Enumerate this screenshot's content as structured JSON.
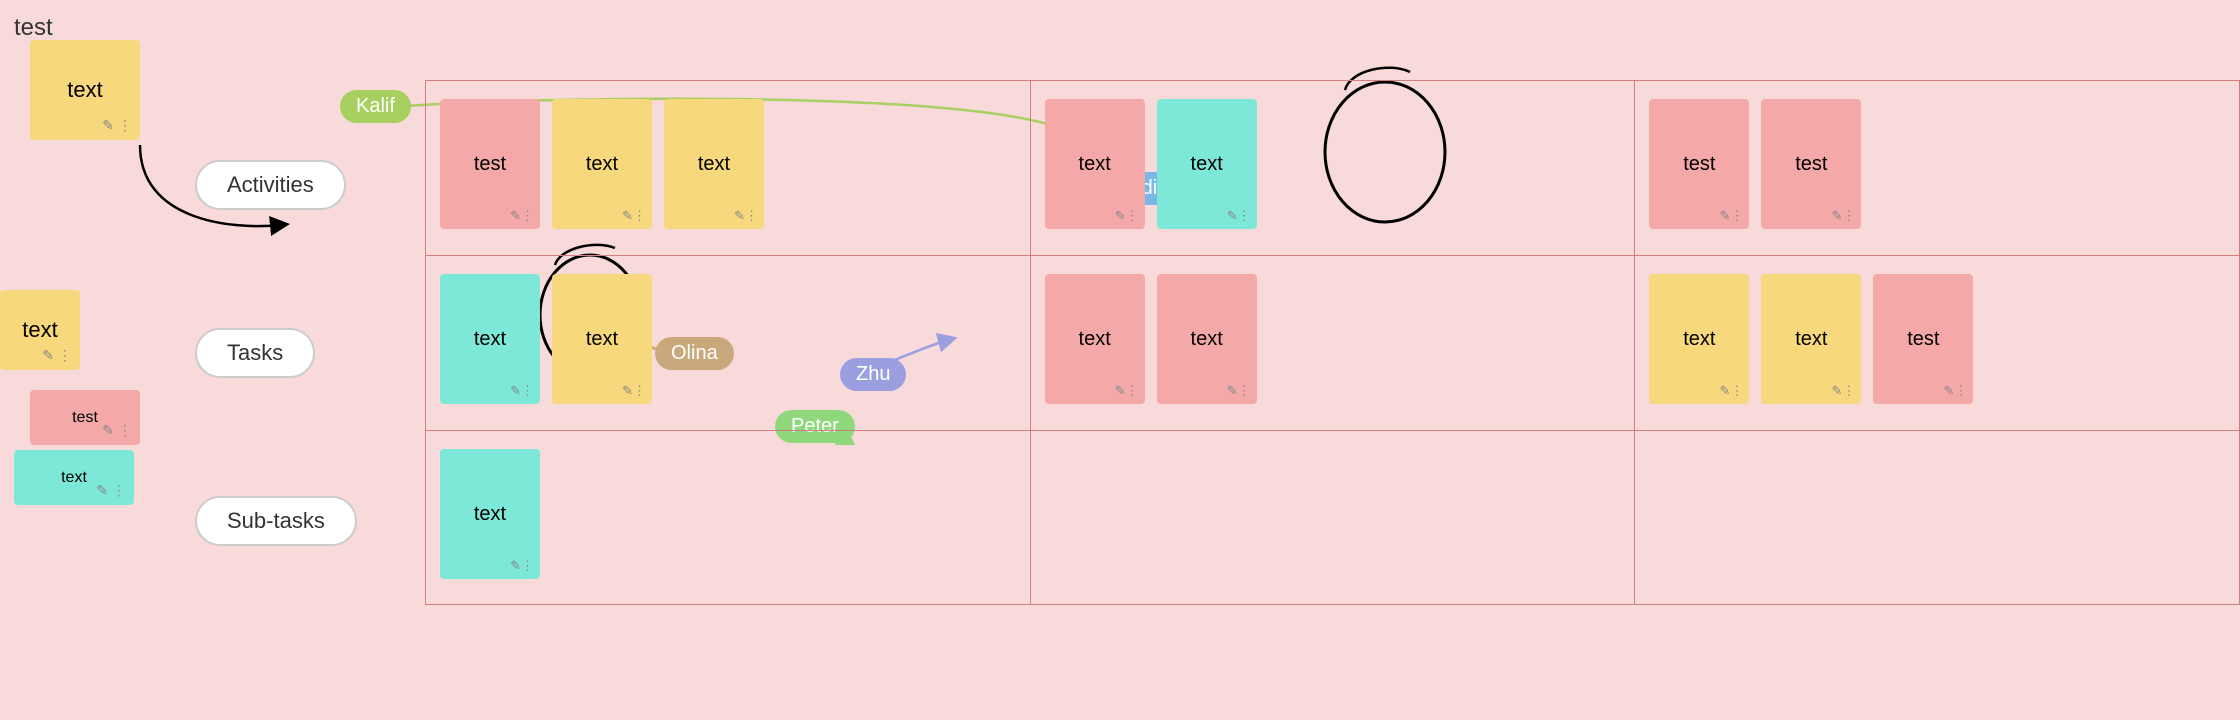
{
  "app": {
    "bg_color": "#f9dada"
  },
  "sidebar": {
    "top_label": "test",
    "sticky1": {
      "text": "text",
      "color": "yellow"
    },
    "sticky2": {
      "text": "text",
      "color": "yellow"
    },
    "sticky3": {
      "text": "test",
      "color": "pink"
    },
    "sticky4": {
      "text": "text",
      "color": "teal"
    },
    "btn_activities": "Activities",
    "btn_tasks": "Tasks",
    "btn_subtasks": "Sub-tasks"
  },
  "user_labels": {
    "kalif": "Kalif",
    "nadia": "Nadia",
    "olina": "Olina",
    "zhu": "Zhu",
    "peter": "Peter"
  },
  "grid": {
    "rows": [
      {
        "cells": [
          {
            "stickies": [
              {
                "text": "test",
                "color": "pink"
              },
              {
                "text": "text",
                "color": "yellow"
              },
              {
                "text": "text",
                "color": "yellow"
              }
            ]
          },
          {
            "stickies": [
              {
                "text": "text",
                "color": "pink"
              },
              {
                "text": "text",
                "color": "teal"
              }
            ]
          },
          {
            "stickies": [
              {
                "text": "test",
                "color": "pink"
              },
              {
                "text": "test",
                "color": "pink"
              }
            ]
          }
        ]
      },
      {
        "cells": [
          {
            "stickies": [
              {
                "text": "text",
                "color": "teal"
              },
              {
                "text": "text",
                "color": "yellow"
              }
            ]
          },
          {
            "stickies": [
              {
                "text": "text",
                "color": "pink"
              },
              {
                "text": "text",
                "color": "pink"
              }
            ]
          },
          {
            "stickies": [
              {
                "text": "text",
                "color": "yellow"
              },
              {
                "text": "text",
                "color": "yellow"
              },
              {
                "text": "test",
                "color": "pink"
              }
            ]
          }
        ]
      },
      {
        "cells": [
          {
            "stickies": [
              {
                "text": "text",
                "color": "teal"
              }
            ]
          },
          {
            "stickies": []
          },
          {
            "stickies": []
          }
        ]
      }
    ]
  }
}
